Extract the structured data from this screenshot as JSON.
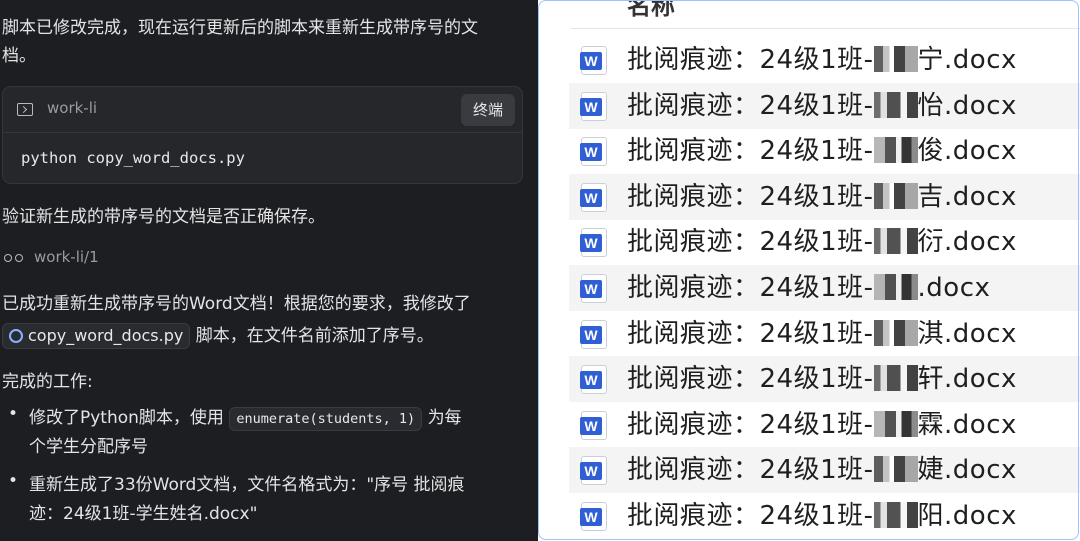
{
  "chat": {
    "intro_line1": "脚本已修改完成，现在运行更新后的脚本来重新生成带序号的文",
    "intro_line2": "档。",
    "terminal": {
      "cwd": "work-li",
      "button_label": "终端",
      "command": "python copy_word_docs.py"
    },
    "verify_text": "验证新生成的带序号的文档是否正确保存。",
    "tool_path": "work-li/1",
    "result_line1": "已成功重新生成带序号的Word文档！根据您的要求，我修改了",
    "result_file_chip": "copy_word_docs.py",
    "result_line2_after": "脚本，在文件名前添加了序号。",
    "done_heading": "完成的工作:",
    "bullets": [
      {
        "line1_before": "修改了Python脚本，使用",
        "code": "enumerate(students, 1)",
        "line1_after": "为每",
        "line2": "个学生分配序号"
      },
      {
        "line1": "重新生成了33份Word文档，文件名格式为：\"序号 批阅痕",
        "line2": "迹：24级1班-学生姓名.docx\""
      }
    ]
  },
  "files": {
    "column_header": "名称",
    "icon": "word-doc-icon",
    "rows": [
      {
        "prefix": "批阅痕迹：24级1班-",
        "suffix": "宁.docx",
        "mosaic": 1
      },
      {
        "prefix": "批阅痕迹：24级1班-",
        "suffix": "怡.docx",
        "mosaic": 2
      },
      {
        "prefix": "批阅痕迹：24级1班-",
        "suffix": "俊.docx",
        "mosaic": 3
      },
      {
        "prefix": "批阅痕迹：24级1班-",
        "suffix": "吉.docx",
        "mosaic": 1
      },
      {
        "prefix": "批阅痕迹：24级1班-",
        "suffix": "衍.docx",
        "mosaic": 2
      },
      {
        "prefix": "批阅痕迹：24级1班-",
        "suffix": ".docx",
        "mosaic": 3
      },
      {
        "prefix": "批阅痕迹：24级1班-",
        "suffix": "淇.docx",
        "mosaic": 1
      },
      {
        "prefix": "批阅痕迹：24级1班-",
        "suffix": "轩.docx",
        "mosaic": 2
      },
      {
        "prefix": "批阅痕迹：24级1班-",
        "suffix": "霖.docx",
        "mosaic": 3
      },
      {
        "prefix": "批阅痕迹：24级1班-",
        "suffix": "婕.docx",
        "mosaic": 1
      },
      {
        "prefix": "批阅痕迹：24级1班-",
        "suffix": "阳.docx",
        "mosaic": 2
      }
    ]
  }
}
